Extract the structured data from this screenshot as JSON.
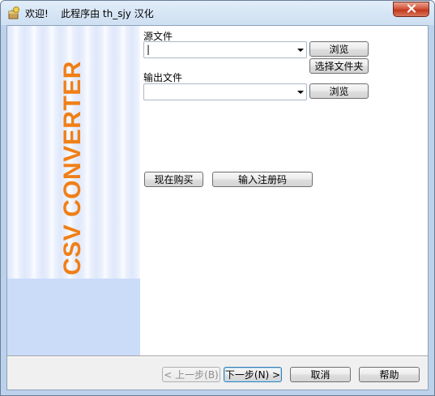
{
  "window": {
    "title": "欢迎!    此程序由 th_sjy 汉化",
    "close_icon": "close-icon",
    "app_icon": "setup-package-icon"
  },
  "banner": {
    "text": "CSV CONVERTER",
    "color": "#f07f17"
  },
  "source": {
    "label": "源文件",
    "value": "|",
    "browse_label": "浏览",
    "select_folder_label": "选择文件夹"
  },
  "output": {
    "label": "输出文件",
    "value": "",
    "browse_label": "浏览"
  },
  "actions": {
    "buy_now_label": "现在购买",
    "enter_code_label": "输入注册码"
  },
  "footer": {
    "back_label": "< 上一步(B)",
    "next_label": "下一步(N) >",
    "cancel_label": "取消",
    "help_label": "帮助"
  }
}
